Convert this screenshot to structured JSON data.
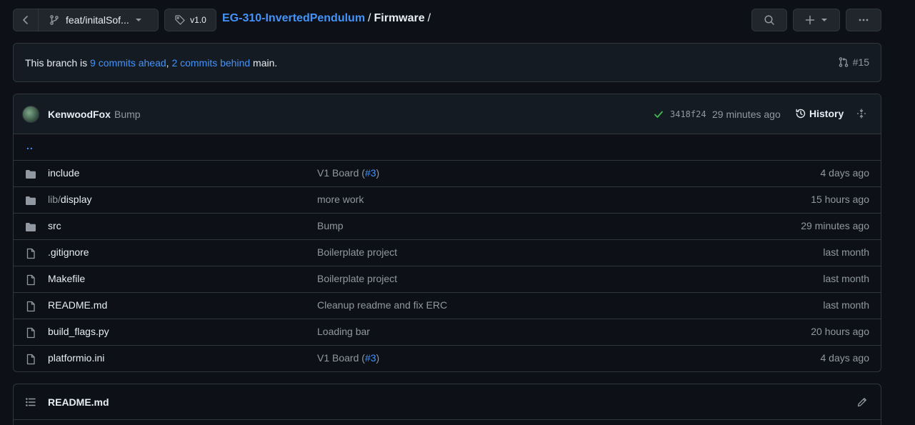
{
  "topbar": {
    "branch": "feat/initalSof...",
    "tag": "v1.0",
    "repo": "EG-310-InvertedPendulum",
    "path": "Firmware",
    "sep1": "/",
    "sep2": "/"
  },
  "branch_info": {
    "prefix": "This branch is",
    "ahead": "9 commits ahead",
    "comma": ",",
    "behind": "2 commits behind",
    "suffix": "main.",
    "pr": "#15"
  },
  "commit": {
    "author": "KenwoodFox",
    "message": "Bump",
    "sha": "3418f24",
    "time": "29 minutes ago",
    "history": "History"
  },
  "parent_dir": "..",
  "files": [
    {
      "type": "dir",
      "name": "include",
      "prefix": "",
      "msg": "V1 Board (",
      "msg_link": "#3",
      "msg_suffix": ")",
      "age": "4 days ago"
    },
    {
      "type": "dir",
      "name": "display",
      "prefix": "lib/",
      "msg": "more work",
      "msg_link": "",
      "msg_suffix": "",
      "age": "15 hours ago"
    },
    {
      "type": "dir",
      "name": "src",
      "prefix": "",
      "msg": "Bump",
      "msg_link": "",
      "msg_suffix": "",
      "age": "29 minutes ago"
    },
    {
      "type": "file",
      "name": ".gitignore",
      "prefix": "",
      "msg": "Boilerplate project",
      "msg_link": "",
      "msg_suffix": "",
      "age": "last month"
    },
    {
      "type": "file",
      "name": "Makefile",
      "prefix": "",
      "msg": "Boilerplate project",
      "msg_link": "",
      "msg_suffix": "",
      "age": "last month"
    },
    {
      "type": "file",
      "name": "README.md",
      "prefix": "",
      "msg": "Cleanup readme and fix ERC",
      "msg_link": "",
      "msg_suffix": "",
      "age": "last month"
    },
    {
      "type": "file",
      "name": "build_flags.py",
      "prefix": "",
      "msg": "Loading bar",
      "msg_link": "",
      "msg_suffix": "",
      "age": "20 hours ago"
    },
    {
      "type": "file",
      "name": "platformio.ini",
      "prefix": "",
      "msg": "V1 Board (",
      "msg_link": "#3",
      "msg_suffix": ")",
      "age": "4 days ago"
    }
  ],
  "readme": {
    "title": "README.md"
  },
  "colors": {
    "bg": "#0d1117",
    "border": "#30363d",
    "link": "#4493f8",
    "muted": "#9198a1",
    "success": "#3fb950"
  }
}
